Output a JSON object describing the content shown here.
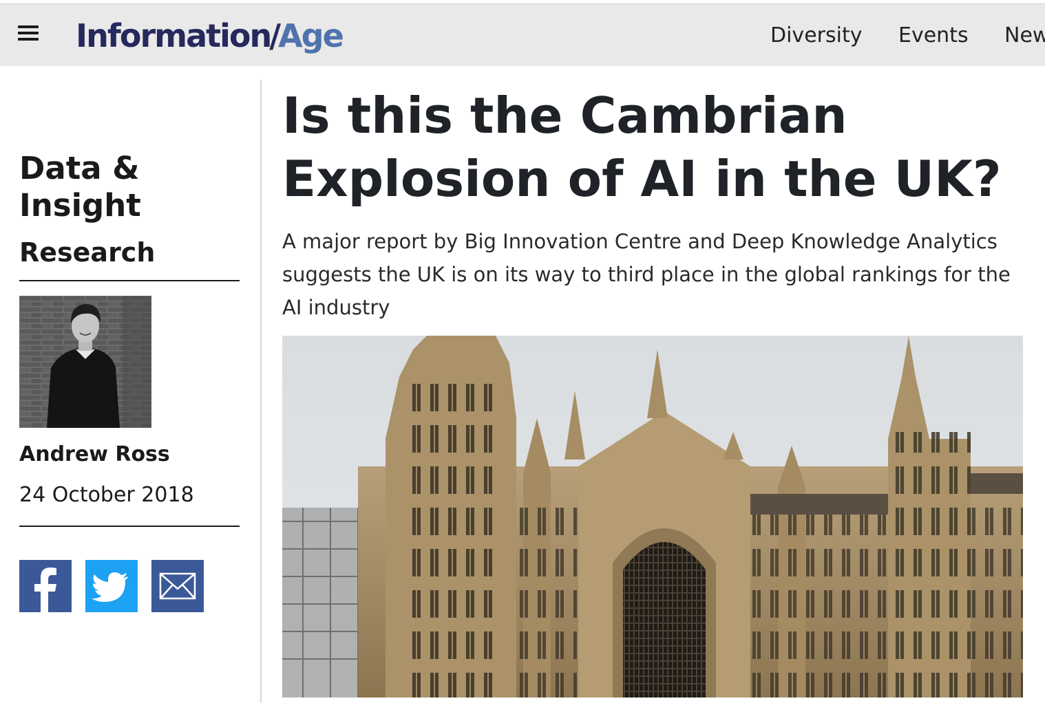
{
  "header": {
    "logo_part1": "Information",
    "logo_slash": "/",
    "logo_part2": "Age",
    "nav": [
      {
        "label": "Diversity"
      },
      {
        "label": "Events"
      },
      {
        "label": "New"
      }
    ]
  },
  "sidebar": {
    "category": "Data & Insight",
    "subcategory": "Research",
    "author": "Andrew Ross",
    "date": "24 October 2018",
    "share": [
      {
        "icon": "facebook-icon",
        "color": "#3b5998"
      },
      {
        "icon": "twitter-icon",
        "color": "#1da1f2"
      },
      {
        "icon": "email-icon",
        "color": "#3b5998"
      }
    ]
  },
  "article": {
    "headline": "Is this the Cambrian Explosion of AI in the UK?",
    "standfirst": "A major report by Big Innovation Centre and Deep Knowledge Analytics suggests the UK is on its way to third place in the global rankings for the AI industry"
  },
  "colors": {
    "logo_dark": "#26295c",
    "logo_light": "#4e73ad",
    "header_bg": "#e9e9e9",
    "facebook": "#3b5998",
    "twitter": "#1da1f2"
  }
}
